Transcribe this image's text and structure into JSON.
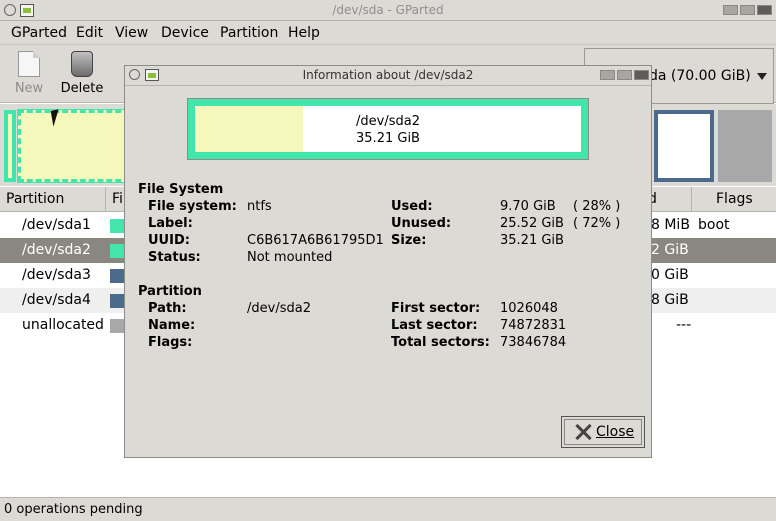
{
  "window": {
    "title": "/dev/sda - GParted"
  },
  "menu": [
    "GParted",
    "Edit",
    "View",
    "Device",
    "Partition",
    "Help"
  ],
  "toolbar": {
    "new_label": "New",
    "delete_label": "Delete"
  },
  "device_selector": {
    "text": "da  (70.00 GiB)"
  },
  "table": {
    "headers": [
      "Partition",
      "Fil",
      "d",
      "Flags"
    ],
    "rows": [
      {
        "partition": "/dev/sda1",
        "size": "8 MiB",
        "flags": "boot",
        "color": "#42e5ac"
      },
      {
        "partition": "/dev/sda2",
        "size": "2 GiB",
        "flags": "",
        "color": "#42e5ac"
      },
      {
        "partition": "/dev/sda3",
        "size": "0 GiB",
        "flags": "",
        "color": "#4c6a8b"
      },
      {
        "partition": "/dev/sda4",
        "size": "8 GiB",
        "flags": "",
        "color": "#4c6a8b"
      },
      {
        "partition": "unallocated",
        "size": "---",
        "flags": "",
        "color": "#a8a8a8"
      }
    ]
  },
  "status": {
    "text": "0 operations pending"
  },
  "dialog": {
    "title": "Information about /dev/sda2",
    "bar": {
      "name": "/dev/sda2",
      "size": "35.21 GiB",
      "used_fraction": 0.28
    },
    "fs_section": "File System",
    "fs": {
      "file_system_label": "File system:",
      "file_system": "ntfs",
      "label_label": "Label:",
      "label": "",
      "uuid_label": "UUID:",
      "uuid": "C6B617A6B61795D1",
      "status_label": "Status:",
      "status": "Not mounted",
      "used_label": "Used:",
      "used": "9.70 GiB",
      "used_pct": "( 28% )",
      "unused_label": "Unused:",
      "unused": "25.52 GiB",
      "unused_pct": "( 72% )",
      "size_label": "Size:",
      "size": "35.21 GiB"
    },
    "part_section": "Partition",
    "part": {
      "path_label": "Path:",
      "path": "/dev/sda2",
      "name_label": "Name:",
      "name": "",
      "flags_label": "Flags:",
      "flags": "",
      "first_sector_label": "First sector:",
      "first_sector": "1026048",
      "last_sector_label": "Last sector:",
      "last_sector": "74872831",
      "total_sectors_label": "Total sectors:",
      "total_sectors": "73846784"
    },
    "close_label": "Close"
  }
}
